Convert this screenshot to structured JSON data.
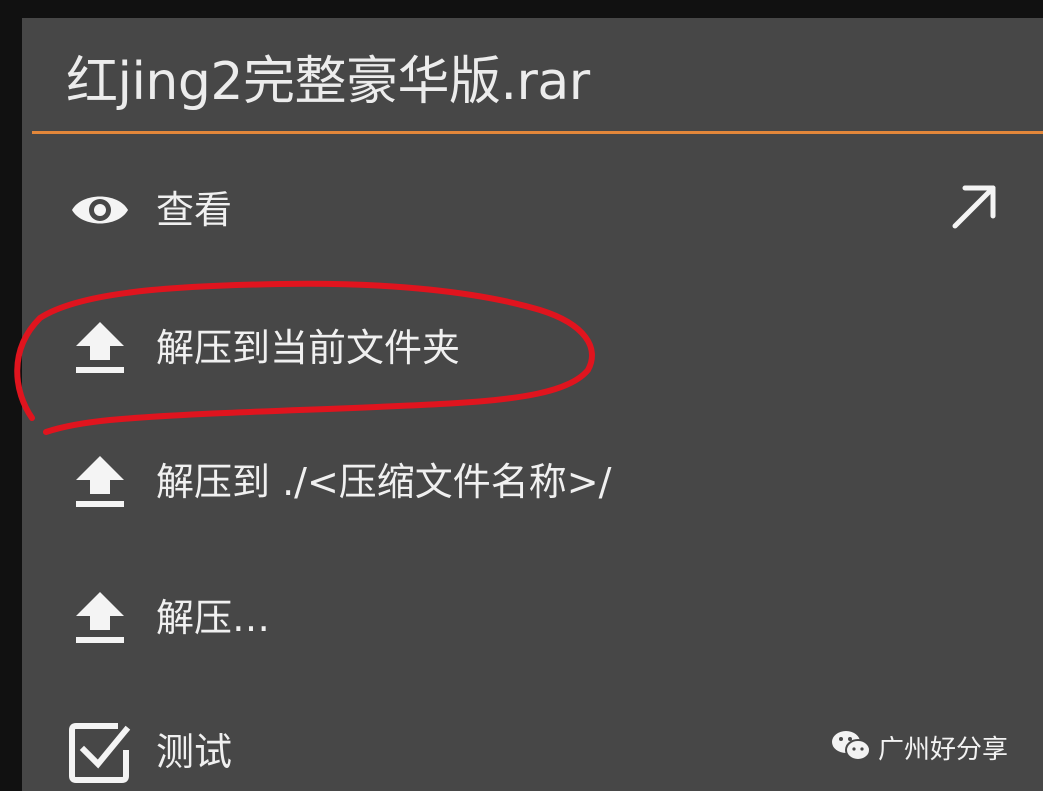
{
  "dialog": {
    "title": "红jing2完整豪华版.rar",
    "accent_color": "#e3873a",
    "items": [
      {
        "label": "查看",
        "icon": "eye-icon"
      },
      {
        "label": "解压到当前文件夹",
        "icon": "upload-icon"
      },
      {
        "label": "解压到 ./<压缩文件名称>/",
        "icon": "upload-icon"
      },
      {
        "label": "解压…",
        "icon": "upload-icon"
      },
      {
        "label": "测试",
        "icon": "checkbox-checked-icon"
      }
    ],
    "open_icon": "arrow-up-right-icon"
  },
  "annotation": {
    "color": "#e0141e",
    "shape": "red-circle-around-item-2"
  },
  "watermark": {
    "text": "广州好分享",
    "icon": "wechat-icon"
  }
}
